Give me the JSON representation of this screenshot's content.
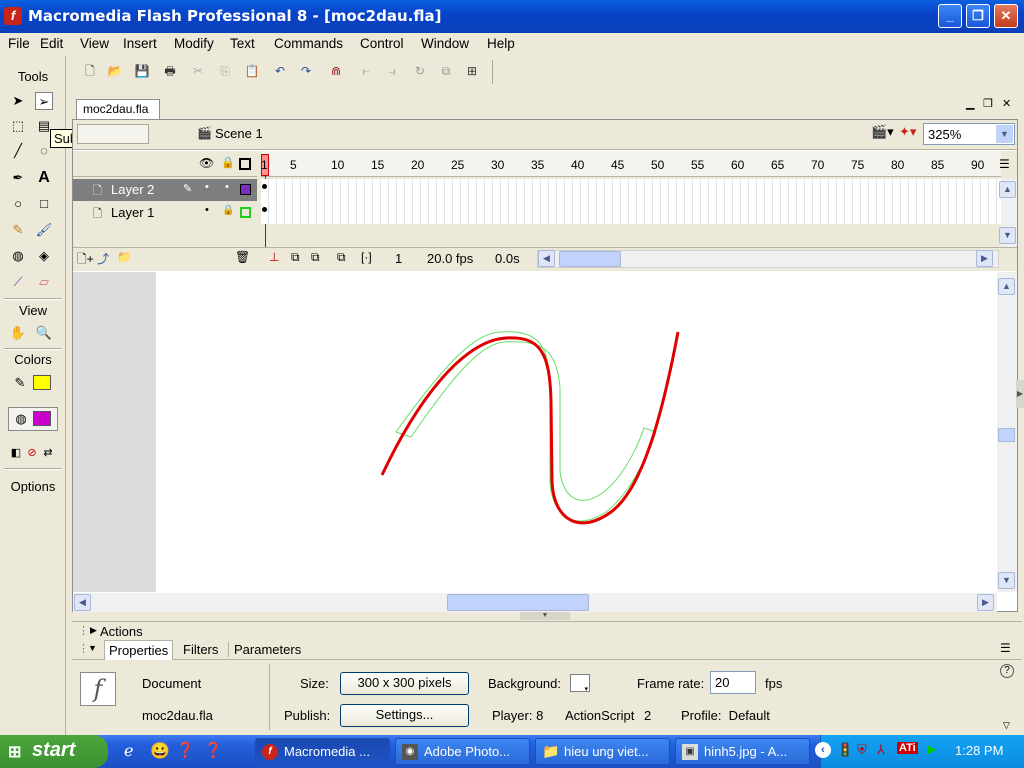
{
  "window": {
    "title": "Macromedia Flash Professional 8 - [moc2dau.fla]",
    "logo": "f"
  },
  "menu": [
    "File",
    "Edit",
    "View",
    "Insert",
    "Modify",
    "Text",
    "Commands",
    "Control",
    "Window",
    "Help"
  ],
  "tools": {
    "header": "Tools",
    "view_header": "View",
    "colors_header": "Colors",
    "options_header": "Options",
    "tooltip": "Subselection Tool (A)"
  },
  "document": {
    "tab": "moc2dau.fla",
    "scene": "Scene 1",
    "zoom": "325%"
  },
  "timeline": {
    "frame_numbers": [
      "1",
      "5",
      "10",
      "15",
      "20",
      "25",
      "30",
      "35",
      "40",
      "45",
      "50",
      "55",
      "60",
      "65",
      "70",
      "75",
      "80",
      "85",
      "90"
    ],
    "layers": [
      {
        "name": "Layer 2",
        "selected": true,
        "outline_color": "#7b2fbf"
      },
      {
        "name": "Layer 1",
        "selected": false,
        "outline_color": "#22cc22"
      }
    ],
    "current_frame": "1",
    "fps": "20.0 fps",
    "elapsed": "0.0s"
  },
  "panels": {
    "actions": "Actions",
    "tabs": [
      "Properties",
      "Filters",
      "Parameters"
    ]
  },
  "properties": {
    "type": "Document",
    "filename": "moc2dau.fla",
    "size_label": "Size:",
    "size_value": "300 x 300 pixels",
    "publish_label": "Publish:",
    "settings_button": "Settings...",
    "background_label": "Background:",
    "frame_rate_label": "Frame rate:",
    "frame_rate_value": "20",
    "fps_unit": "fps",
    "player": "Player: 8",
    "actionscript_label": "ActionScript",
    "actionscript_version": "2",
    "profile": "Profile:  Default"
  },
  "taskbar": {
    "start": "start",
    "buttons": [
      {
        "label": "Macromedia ...",
        "active": true
      },
      {
        "label": "Adobe Photo...",
        "active": false
      },
      {
        "label": "hieu ung viet...",
        "active": false
      },
      {
        "label": "hinh5.jpg - A...",
        "active": false
      }
    ],
    "time": "1:28 PM"
  },
  "colors": {
    "stroke": "#ffff00",
    "fill": "#cc00cc",
    "curve": "#e00000",
    "outline": "#66dd66"
  }
}
